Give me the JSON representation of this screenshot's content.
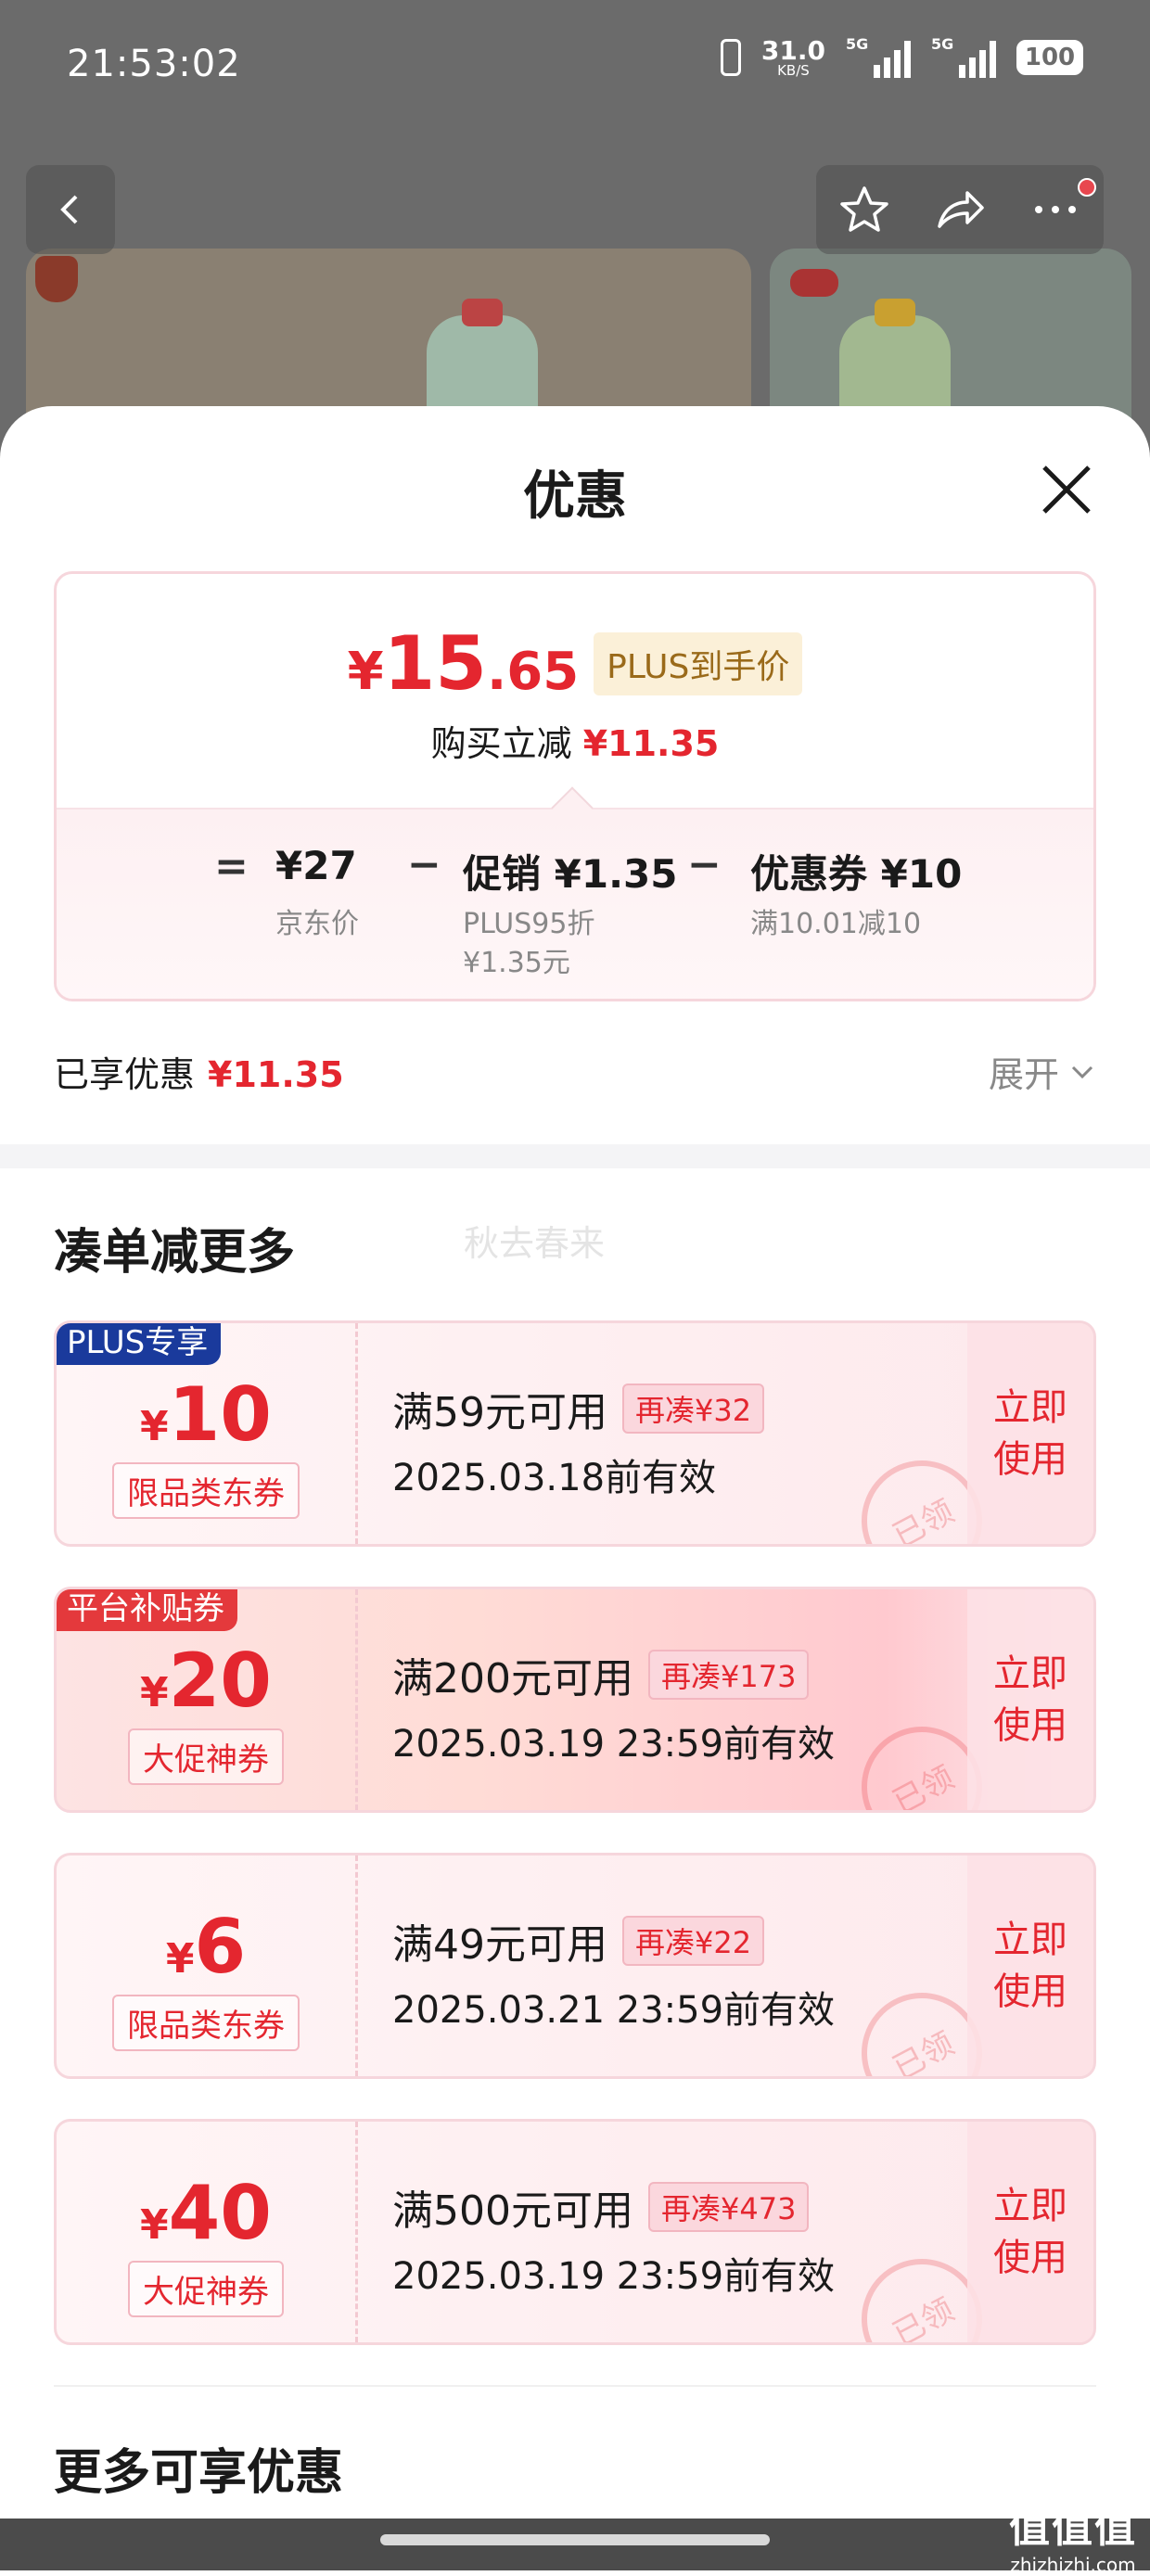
{
  "status_bar": {
    "time": "21:53:02",
    "net_speed_value": "31.0",
    "net_speed_unit": "KB/S",
    "signal1_label": "5G",
    "signal2_label": "5G",
    "battery": "100"
  },
  "sheet": {
    "title": "优惠"
  },
  "price_card": {
    "currency": "¥",
    "price_int": "15",
    "price_dec": ".65",
    "plus_tag": "PLUS到手价",
    "reduce_label": "购买立减",
    "reduce_amount": "¥11.35",
    "equals": "=",
    "minus": "−",
    "jd_price": "¥27",
    "jd_price_label": "京东价",
    "promo": "促销 ¥1.35",
    "promo_note1": "PLUS95折",
    "promo_note2": "¥1.35元",
    "coupon": "优惠券 ¥10",
    "coupon_note": "满10.01减10"
  },
  "enjoyed": {
    "label": "已享优惠",
    "amount": "¥11.35",
    "expand": "展开"
  },
  "section1_title": "凑单减更多",
  "watermark_text": "秋去春来",
  "coupons": [
    {
      "badge": "PLUS专享",
      "currency": "¥",
      "amount": "10",
      "type": "限品类东券",
      "condition": "满59元可用",
      "need": "再凑¥32",
      "valid": "2025.03.18前有效",
      "stamp": "已领",
      "use": "立即使用"
    },
    {
      "badge": "平台补贴券",
      "currency": "¥",
      "amount": "20",
      "type": "大促神券",
      "condition": "满200元可用",
      "need": "再凑¥173",
      "valid": "2025.03.19 23:59前有效",
      "stamp": "已领",
      "use": "立即使用"
    },
    {
      "badge": "",
      "currency": "¥",
      "amount": "6",
      "type": "限品类东券",
      "condition": "满49元可用",
      "need": "再凑¥22",
      "valid": "2025.03.21 23:59前有效",
      "stamp": "已领",
      "use": "立即使用"
    },
    {
      "badge": "",
      "currency": "¥",
      "amount": "40",
      "type": "大促神券",
      "condition": "满500元可用",
      "need": "再凑¥473",
      "valid": "2025.03.19 23:59前有效",
      "stamp": "已领",
      "use": "立即使用"
    }
  ],
  "section2_title": "更多可享优惠",
  "site_mark": {
    "big": "值值值",
    "small": "zhizhizhi.com"
  },
  "colors": {
    "accent": "#e4262f",
    "plus_blue": "#1a3a9c",
    "plus_gold_bg": "#fbf0d8"
  }
}
